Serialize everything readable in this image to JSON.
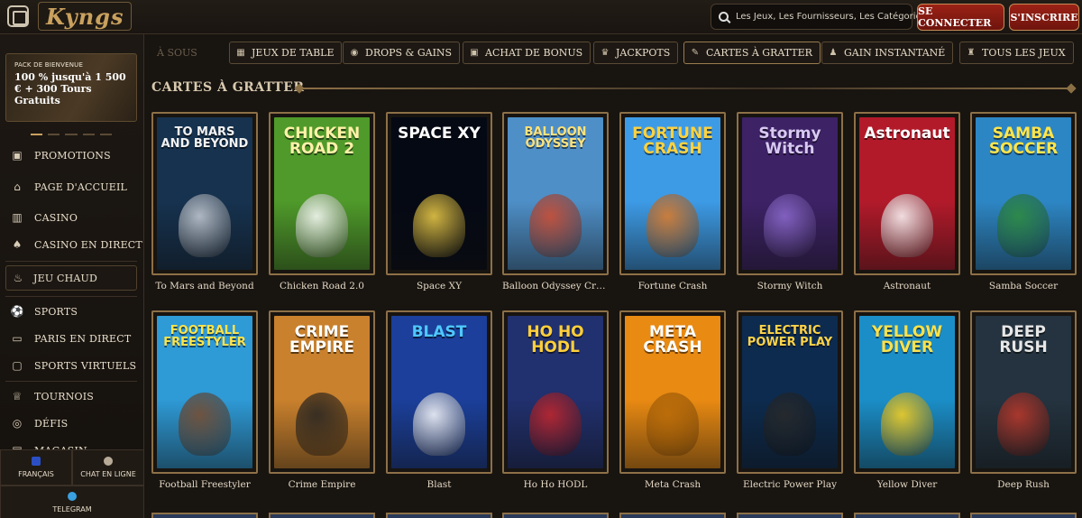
{
  "header": {
    "logo_text": "Kyngs",
    "search_placeholder": "Les Jeux, Les Fournisseurs, Les Catégories",
    "login_label": "SE CONNECTER",
    "signup_label": "S'INSCRIRE"
  },
  "welcome": {
    "kicker": "PACK DE BIENVENUE",
    "offer": "100 % jusqu'à 1 500 € + 300 Tours Gratuits"
  },
  "sidebar": {
    "items": [
      {
        "label": "PROMOTIONS",
        "icon": "gift-icon"
      },
      {
        "label": "PAGE D'ACCUEIL",
        "icon": "home-icon"
      },
      {
        "label": "CASINO",
        "icon": "casino-icon"
      },
      {
        "label": "CASINO EN DIRECT",
        "icon": "cards-icon"
      },
      {
        "label": "JEU CHAUD",
        "icon": "fire-icon"
      },
      {
        "label": "SPORTS",
        "icon": "ball-icon"
      },
      {
        "label": "PARIS EN DIRECT",
        "icon": "live-icon"
      },
      {
        "label": "SPORTS VIRTUELS",
        "icon": "monitor-icon"
      },
      {
        "label": "TOURNOIS",
        "icon": "trophy-icon"
      },
      {
        "label": "DÉFIS",
        "icon": "coins-icon"
      },
      {
        "label": "MAGASIN",
        "icon": "shop-icon"
      }
    ],
    "language_label": "FRANÇAIS",
    "chat_label": "CHAT EN LIGNE",
    "telegram_label": "TELEGRAM"
  },
  "tabs": [
    {
      "label": "À SOUS",
      "icon": "slot-icon"
    },
    {
      "label": "JEUX DE TABLE",
      "icon": "table-icon"
    },
    {
      "label": "DROPS & GAINS",
      "icon": "drops-icon"
    },
    {
      "label": "ACHAT DE BONUS",
      "icon": "bonus-icon"
    },
    {
      "label": "JACKPOTS",
      "icon": "jackpot-icon"
    },
    {
      "label": "CARTES À GRATTER",
      "icon": "scratch-icon"
    },
    {
      "label": "GAIN INSTANTANÉ",
      "icon": "instant-icon"
    },
    {
      "label": "TOUS LES JEUX",
      "icon": "all-games-icon"
    }
  ],
  "section_title": "CARTES À GRATTER",
  "games": [
    {
      "name": "To Mars and Beyond",
      "logo": "TO MARS AND BEYOND",
      "bg": "#16324f",
      "fg": "#f2f2f2",
      "accent": "#c9cfd8"
    },
    {
      "name": "Chicken Road 2.0",
      "logo": "CHICKEN ROAD 2",
      "bg": "#4f9a2a",
      "fg": "#fff2a8",
      "accent": "#ffffff"
    },
    {
      "name": "Space XY",
      "logo": "SPACE XY",
      "bg": "#050914",
      "fg": "#ffffff",
      "accent": "#f4d24a"
    },
    {
      "name": "Balloon Odyssey Crash",
      "logo": "BALLOON ODYSSEY",
      "bg": "#4e8fc7",
      "fg": "#ffe27a",
      "accent": "#d24a2c"
    },
    {
      "name": "Fortune Crash",
      "logo": "FORTUNE CRASH",
      "bg": "#3d9be6",
      "fg": "#ffd23f",
      "accent": "#e27b25"
    },
    {
      "name": "Stormy Witch",
      "logo": "Stormy Witch",
      "bg": "#3d2266",
      "fg": "#d8c9f2",
      "accent": "#8e6bd1"
    },
    {
      "name": "Astronaut",
      "logo": "Astronaut",
      "bg": "#b21a2a",
      "fg": "#ffffff",
      "accent": "#ffffff"
    },
    {
      "name": "Samba Soccer",
      "logo": "SAMBA SOCCER",
      "bg": "#2d86c4",
      "fg": "#ffe54a",
      "accent": "#2e8c3a"
    },
    {
      "name": "Football Freestyler",
      "logo": "FOOTBALL FREESTYLER",
      "bg": "#2e9ad6",
      "fg": "#ffe34a",
      "accent": "#7a4a2a"
    },
    {
      "name": "Crime Empire",
      "logo": "CRIME EMPIRE",
      "bg": "#c9812d",
      "fg": "#ffffff",
      "accent": "#222222"
    },
    {
      "name": "Blast",
      "logo": "BLAST",
      "bg": "#1b3f9a",
      "fg": "#4fc8ff",
      "accent": "#ffffff"
    },
    {
      "name": "Ho Ho HODL",
      "logo": "HO HO HODL",
      "bg": "#21306e",
      "fg": "#ffcf3a",
      "accent": "#c7262b"
    },
    {
      "name": "Meta Crash",
      "logo": "META CRASH",
      "bg": "#e98a12",
      "fg": "#ffffff",
      "accent": "#b86a08"
    },
    {
      "name": "Electric Power Play",
      "logo": "ELECTRIC POWER PLAY",
      "bg": "#0d2b4e",
      "fg": "#ffd34a",
      "accent": "#2a2a2a"
    },
    {
      "name": "Yellow Diver",
      "logo": "YELLOW DIVER",
      "bg": "#1b8ec7",
      "fg": "#ffe14a",
      "accent": "#ffd21a"
    },
    {
      "name": "Deep Rush",
      "logo": "DEEP RUSH",
      "bg": "#24333f",
      "fg": "#e7e7e7",
      "accent": "#c0392b"
    }
  ]
}
